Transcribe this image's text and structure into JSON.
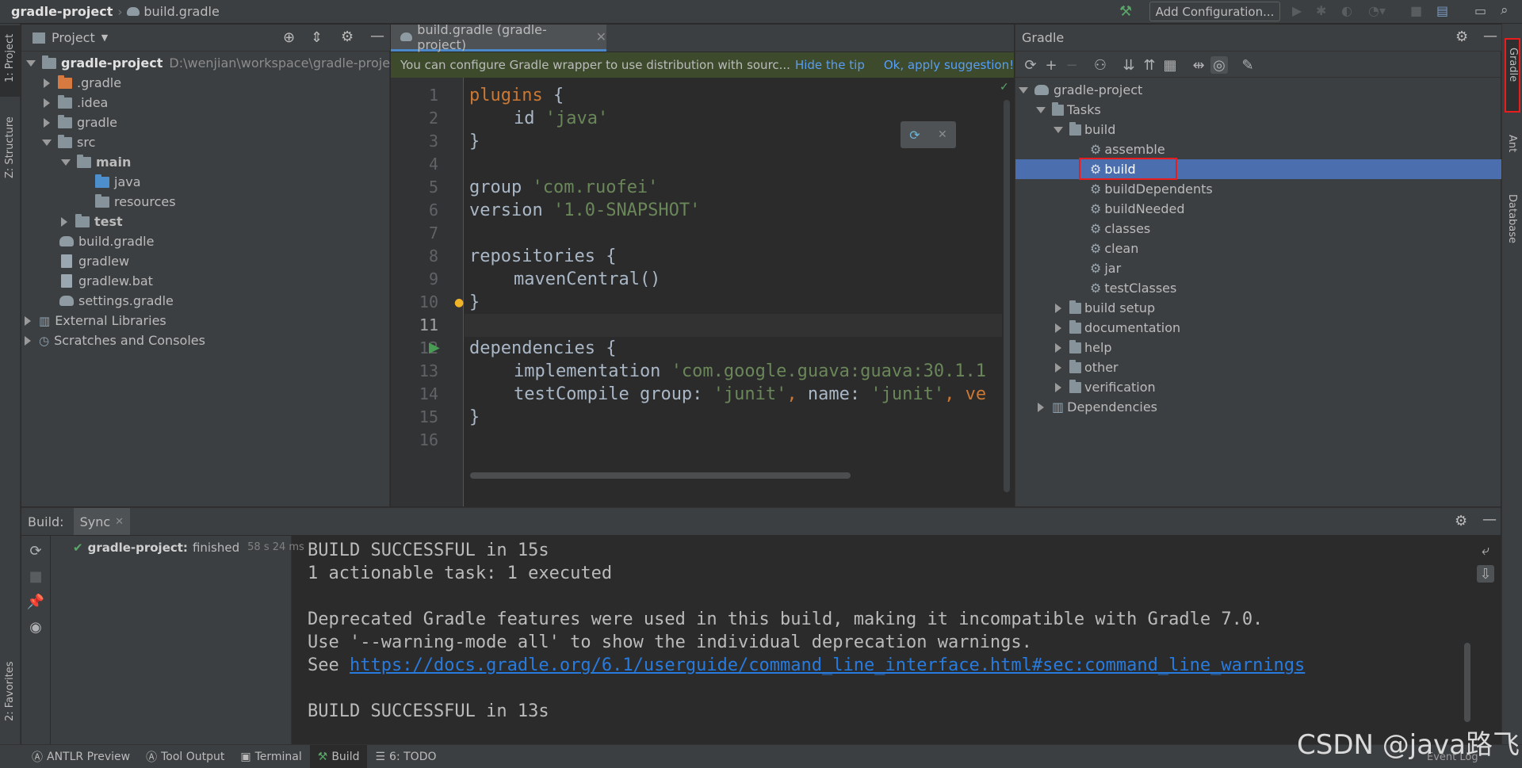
{
  "topbar": {
    "project": "gradle-project",
    "file": "build.gradle",
    "run_config": "Add Configuration..."
  },
  "left_stripe": {
    "project": "1: Project",
    "structure": "Z: Structure",
    "favorites": "2: Favorites"
  },
  "right_stripe": {
    "gradle": "Gradle",
    "ant": "Ant",
    "database": "Database"
  },
  "project_panel": {
    "title": "Project",
    "root_name": "gradle-project",
    "root_path": "D:\\wenjian\\workspace\\gradle-project",
    "items": [
      {
        "label": ".gradle"
      },
      {
        "label": ".idea"
      },
      {
        "label": "gradle"
      },
      {
        "label": "src"
      },
      {
        "label": "main"
      },
      {
        "label": "java"
      },
      {
        "label": "resources"
      },
      {
        "label": "test"
      },
      {
        "label": "build.gradle"
      },
      {
        "label": "gradlew"
      },
      {
        "label": "gradlew.bat"
      },
      {
        "label": "settings.gradle"
      },
      {
        "label": "External Libraries"
      },
      {
        "label": "Scratches and Consoles"
      }
    ]
  },
  "editor": {
    "tab_label": "build.gradle (gradle-project)",
    "tip_text": "You can configure Gradle wrapper to use distribution with sourc...",
    "hide_tip": "Hide the tip",
    "apply": "Ok, apply suggestion!",
    "line_numbers": [
      "1",
      "2",
      "3",
      "4",
      "5",
      "6",
      "7",
      "8",
      "9",
      "10",
      "11",
      "12",
      "13",
      "14",
      "15",
      "16"
    ],
    "code": {
      "l1_kw": "plugins",
      "l1_rest": " {",
      "l2_id": "id",
      "l2_str": "'java'",
      "l3": "}",
      "l5_kw": "group",
      "l5_str": "'com.ruofei'",
      "l6_kw": "version",
      "l6_str": "'1.0-SNAPSHOT'",
      "l8_kw": "repositories",
      "l8_rest": " {",
      "l9": "mavenCentral()",
      "l10": "}",
      "l12_kw": "dependencies",
      "l12_rest": " {",
      "l13_kw": "implementation",
      "l13_str": "'com.google.guava:guava:30.1.1",
      "l14_kw": "testCompile",
      "l14_named1": "group:",
      "l14_str1": "'junit'",
      "l14_comma": ",",
      "l14_named2": "name:",
      "l14_str2": "'junit'",
      "l14_tail": ", ve",
      "l15": "}"
    }
  },
  "gradle_panel": {
    "title": "Gradle",
    "root": "gradle-project",
    "tasks": "Tasks",
    "build_group": "build",
    "build_tasks": [
      "assemble",
      "build",
      "buildDependents",
      "buildNeeded",
      "classes",
      "clean",
      "jar",
      "testClasses"
    ],
    "groups": [
      "build setup",
      "documentation",
      "help",
      "other",
      "verification"
    ],
    "dependencies": "Dependencies"
  },
  "build_panel": {
    "label": "Build:",
    "tab": "Sync",
    "result_name": "gradle-project:",
    "result_status": "finished",
    "result_time": "58 s 24 ms",
    "console": [
      "BUILD SUCCESSFUL in 15s",
      "1 actionable task: 1 executed",
      "",
      "Deprecated Gradle features were used in this build, making it incompatible with Gradle 7.0.",
      "Use '--warning-mode all' to show the individual deprecation warnings.",
      "See ",
      "",
      "BUILD SUCCESSFUL in 13s"
    ],
    "console_link": "https://docs.gradle.org/6.1/userguide/command_line_interface.html#sec:command_line_warnings"
  },
  "bottom_tabs": [
    "ANTLR Preview",
    "Tool Output",
    "Terminal",
    "Build",
    "6: TODO"
  ],
  "event_log": "Event Log",
  "watermark": "CSDN @java路飞",
  "colors": {
    "highlight": "#4b6eaf",
    "red_box": "#e81e1e",
    "keyword": "#cc7832",
    "string": "#6a8759",
    "link": "#287bde"
  }
}
